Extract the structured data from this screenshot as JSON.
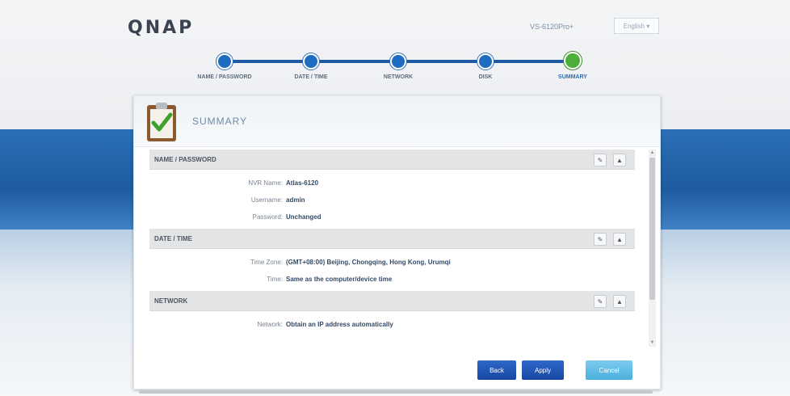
{
  "header": {
    "logo": "QNAP",
    "model": "VS-6120Pro+",
    "language": "English ▾"
  },
  "steps": [
    {
      "label": "NAME / PASSWORD",
      "active": false
    },
    {
      "label": "DATE / TIME",
      "active": false
    },
    {
      "label": "NETWORK",
      "active": false
    },
    {
      "label": "DISK",
      "active": false
    },
    {
      "label": "SUMMARY",
      "active": true
    }
  ],
  "dialog": {
    "title": "SUMMARY",
    "sections": [
      {
        "title": "NAME / PASSWORD",
        "rows": [
          {
            "label": "NVR Name:",
            "value": "Atlas-6120"
          },
          {
            "label": "Username:",
            "value": "admin"
          },
          {
            "label": "Password:",
            "value": "Unchanged"
          }
        ]
      },
      {
        "title": "DATE / TIME",
        "rows": [
          {
            "label": "Time Zone:",
            "value": "(GMT+08:00) Beijing, Chongqing, Hong Kong, Urumqi"
          },
          {
            "label": "Time:",
            "value": "Same as the computer/device time"
          }
        ]
      },
      {
        "title": "NETWORK",
        "rows": [
          {
            "label": "Network:",
            "value": "Obtain an IP address automatically"
          }
        ]
      }
    ],
    "buttons": {
      "back": "Back",
      "apply": "Apply",
      "cancel": "Cancel"
    },
    "section_controls": {
      "edit": "✎",
      "collapse": "▲"
    }
  },
  "colors": {
    "accent": "#1d5aa3",
    "success": "#4caf3a",
    "band": "#2a6fb5"
  }
}
